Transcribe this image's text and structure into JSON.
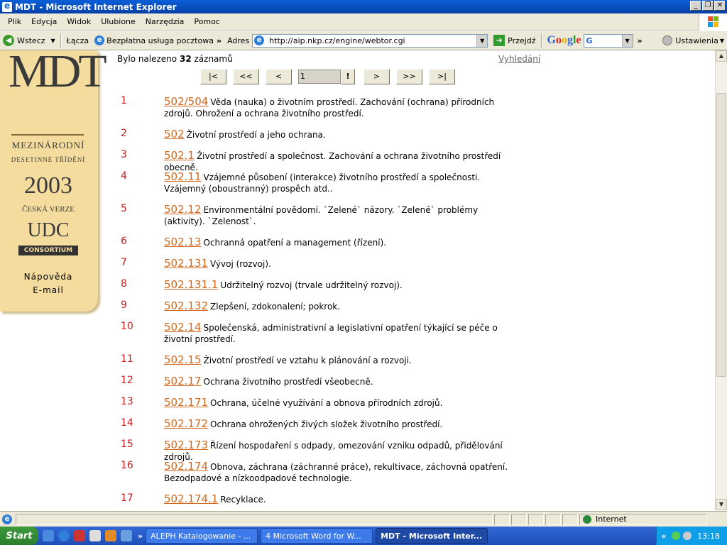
{
  "window": {
    "title": "MDT - Microsoft Internet Explorer"
  },
  "menubar": {
    "items": [
      "Plik",
      "Edycja",
      "Widok",
      "Ulubione",
      "Narzędzia",
      "Pomoc"
    ]
  },
  "toolbar": {
    "back_label": "Wstecz",
    "links_label": "Łącza",
    "email_label": "Bezpłatna usługa pocztowa",
    "address_label": "Adres",
    "url": "http://aip.nkp.cz/engine/webtor.cgi",
    "go_label": "Przejdź",
    "google_label": "Google",
    "google_g": "G",
    "settings_label": "Ustawienia"
  },
  "sidebar": {
    "logo_text": "MDT",
    "subtitle1": "MEZINÁRODNÍ",
    "subtitle2": "DESETINNÉ TŘÍDĚNÍ",
    "year": "2003",
    "edition": "ČESKÁ VERZE",
    "udc": "UDC",
    "consortium": "CONSORTIUM",
    "links": [
      "Nápověda",
      "E-mail"
    ]
  },
  "results": {
    "found_prefix": "Bylo nalezeno",
    "count": "32",
    "found_suffix": "záznamů",
    "search_link": "Vyhledání"
  },
  "pager": {
    "first": "|<",
    "prev_page": "<<",
    "prev": "<",
    "page_value": "1",
    "go": "!",
    "next": ">",
    "next_page": ">>",
    "last": ">|"
  },
  "records": [
    {
      "n": "1",
      "code": "502/504",
      "text": "Věda (nauka) o životním prostředí. Zachování (ochrana) přírodních zdrojů. Ohrožení a ochrana životního prostředí."
    },
    {
      "n": "2",
      "code": "502",
      "text": "Životní prostředí a jeho ochrana."
    },
    {
      "n": "3",
      "code": "502.1",
      "text": "Životní prostředí a společnost. Zachování a ochrana životního prostředí obecně."
    },
    {
      "n": "4",
      "code": "502.11",
      "text": "Vzájemné působení (interakce) životního prostředí a společnosti. Vzájemný (oboustranný) prospěch atd.."
    },
    {
      "n": "5",
      "code": "502.12",
      "text": "Environmentální povědomí. `Zelené` názory. `Zelené` problémy (aktivity). `Zelenost`."
    },
    {
      "n": "6",
      "code": "502.13",
      "text": "Ochranná opatření a management (řízení)."
    },
    {
      "n": "7",
      "code": "502.131",
      "text": "Vývoj (rozvoj)."
    },
    {
      "n": "8",
      "code": "502.131.1",
      "text": "Udržitelný rozvoj (trvale udržitelný rozvoj)."
    },
    {
      "n": "9",
      "code": "502.132",
      "text": "Zlepšení, zdokonalení; pokrok."
    },
    {
      "n": "10",
      "code": "502.14",
      "text": "Společenská, administrativní a legislativní opatření týkající se péče o životní prostředí."
    },
    {
      "n": "11",
      "code": "502.15",
      "text": "Životní prostředí ve vztahu k plánování a rozvoji."
    },
    {
      "n": "12",
      "code": "502.17",
      "text": "Ochrana životního prostředí všeobecně."
    },
    {
      "n": "13",
      "code": "502.171",
      "text": "Ochrana, účelné využívání a obnova přírodních zdrojů."
    },
    {
      "n": "14",
      "code": "502.172",
      "text": "Ochrana ohrožených živých složek životního prostředí."
    },
    {
      "n": "15",
      "code": "502.173",
      "text": "Řízení hospodaření s odpady, omezování vzniku odpadů, přidělování zdrojů."
    },
    {
      "n": "16",
      "code": "502.174",
      "text": "Obnova, záchrana (záchranné práce), rekultivace, záchovná opatření. Bezodpadové a nízkoodpadové technologie."
    },
    {
      "n": "17",
      "code": "502.174.1",
      "text": "Recyklace."
    }
  ],
  "statusbar": {
    "zone": "Internet"
  },
  "taskbar": {
    "start": "Start",
    "tasks": [
      "ALEPH Katalogowanie - ...",
      "4 Microsoft Word for W...",
      "MDT - Microsoft Inter..."
    ],
    "clock": "13:18"
  }
}
